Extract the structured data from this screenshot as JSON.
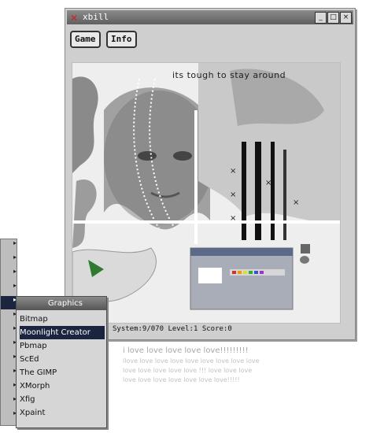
{
  "window": {
    "title": "xbill",
    "controls": {
      "minimize": "_",
      "maximize": "□",
      "close": "×"
    },
    "menu": {
      "game": "Game",
      "info": "Info"
    },
    "overlay_text": "its tough to stay around",
    "status": {
      "system": "System:9/070",
      "level": "Level:1",
      "score": "Score:0"
    }
  },
  "desktop_text": {
    "line1": "i love love love love love!!!!!!!!!",
    "line2": "ilove love love love love love love love love",
    "line3": "love love love love love !!! love love love",
    "line4": "love love love love love love love!!!!!"
  },
  "root_menu": {
    "active_index": 4,
    "item_count": 13
  },
  "submenu": {
    "title": "Graphics",
    "items": [
      {
        "label": "Bitmap",
        "selected": false
      },
      {
        "label": "Moonlight Creator",
        "selected": true
      },
      {
        "label": "Pbmap",
        "selected": false
      },
      {
        "label": "ScEd",
        "selected": false
      },
      {
        "label": "The GIMP",
        "selected": false
      },
      {
        "label": "XMorph",
        "selected": false
      },
      {
        "label": "Xfig",
        "selected": false
      },
      {
        "label": "Xpaint",
        "selected": false
      }
    ]
  }
}
